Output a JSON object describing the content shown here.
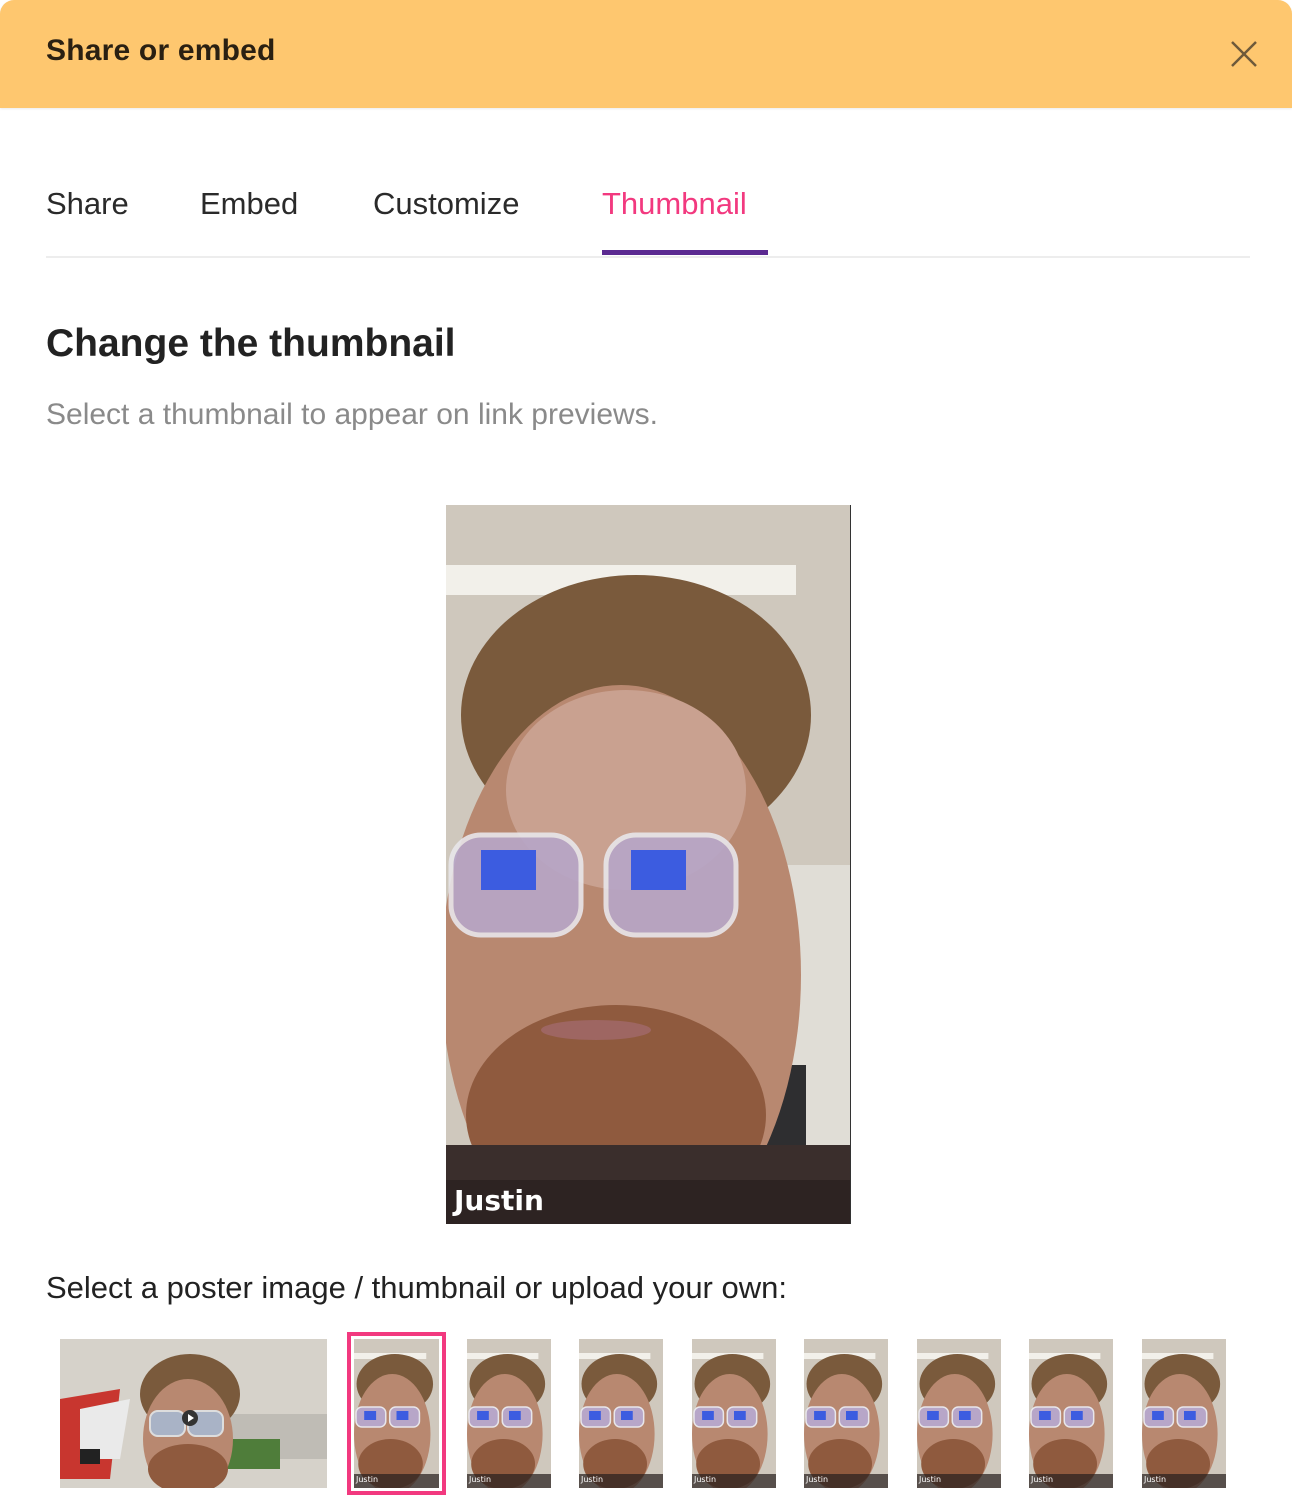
{
  "dialog": {
    "title": "Share or embed",
    "close_icon": "close-icon"
  },
  "tabs": [
    {
      "label": "Share",
      "active": false
    },
    {
      "label": "Embed",
      "active": false
    },
    {
      "label": "Customize",
      "active": false
    },
    {
      "label": "Thumbnail",
      "active": true
    }
  ],
  "content": {
    "title": "Change the thumbnail",
    "subtitle": "Select a thumbnail to appear on link previews.",
    "preview": {
      "name_label": "Justin",
      "description": "Selfie of man with glasses in office"
    },
    "select_label": "Select a poster image / thumbnail or upload your own:"
  },
  "thumbnails": [
    {
      "label": "",
      "type": "landscape",
      "selected": false,
      "description": "Office wide shot with play button"
    },
    {
      "label": "Justin",
      "type": "portrait",
      "selected": true
    },
    {
      "label": "Justin",
      "type": "portrait",
      "selected": false
    },
    {
      "label": "Justin",
      "type": "portrait",
      "selected": false
    },
    {
      "label": "Justin",
      "type": "portrait",
      "selected": false
    },
    {
      "label": "Justin",
      "type": "portrait",
      "selected": false
    },
    {
      "label": "Justin",
      "type": "portrait",
      "selected": false
    },
    {
      "label": "Justin",
      "type": "portrait",
      "selected": false
    },
    {
      "label": "Justin",
      "type": "portrait",
      "selected": false
    }
  ],
  "colors": {
    "header_bg": "#fec76f",
    "active_tab_text": "#f2397f",
    "active_tab_underline": "#5b2a91",
    "selected_thumb_border": "#f2397f"
  }
}
